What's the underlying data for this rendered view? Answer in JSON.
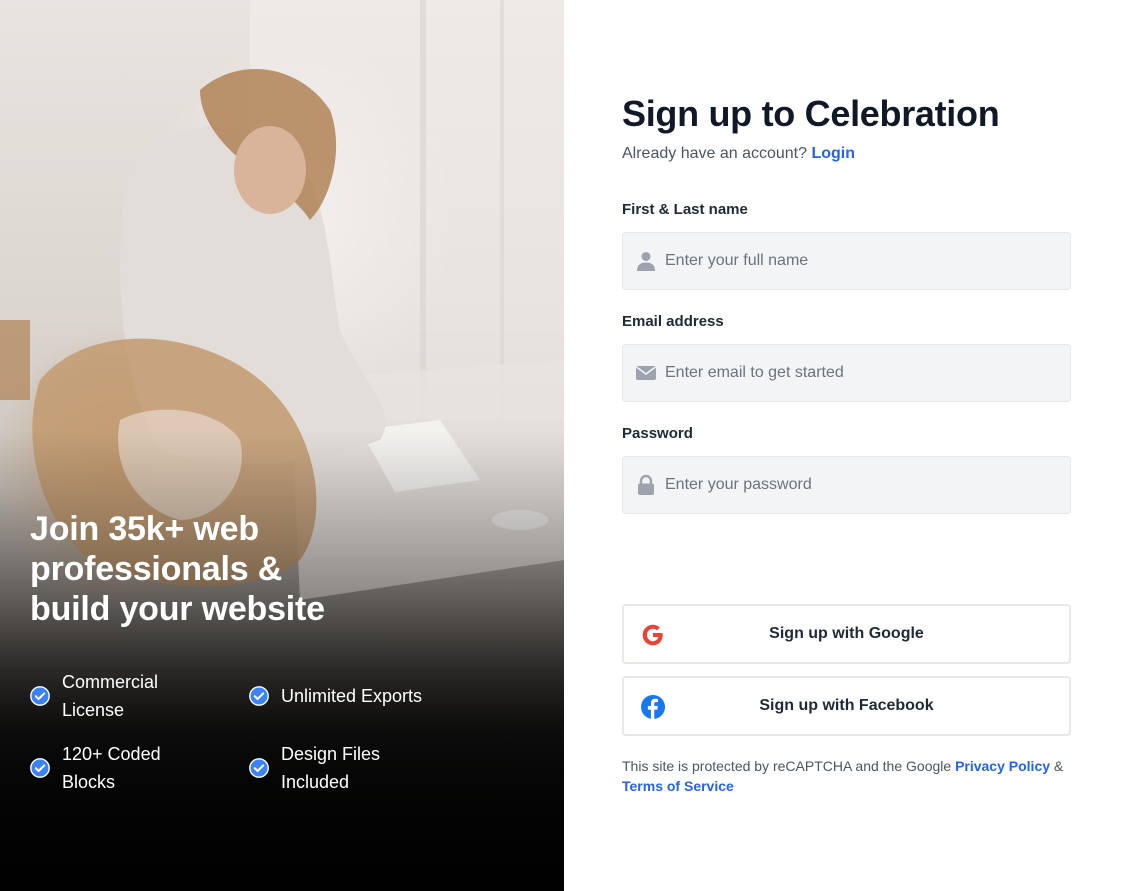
{
  "hero": {
    "title_lines": [
      "Join 35k+ web",
      "professionals &",
      "build your website"
    ],
    "features": [
      {
        "label": "Commercial License",
        "icon": "check-badge-icon"
      },
      {
        "label": "Unlimited Exports",
        "icon": "check-badge-icon"
      },
      {
        "label": "120+ Coded Blocks",
        "icon": "check-badge-icon"
      },
      {
        "label": "Design Files Included",
        "icon": "check-badge-icon"
      }
    ]
  },
  "form": {
    "title": "Sign up to Celebration",
    "have_account_text": "Already have an account?",
    "login_link": "Login",
    "fields": {
      "name": {
        "label": "First & Last name",
        "placeholder": "Enter your full name",
        "value": "",
        "icon": "user-icon"
      },
      "email": {
        "label": "Email address",
        "placeholder": "Enter email to get started",
        "value": "",
        "icon": "envelope-icon"
      },
      "password": {
        "label": "Password",
        "placeholder": "Enter your password",
        "value": "",
        "icon": "lock-icon"
      }
    },
    "google_button": {
      "label": "Sign up with Google",
      "icon": "google-icon"
    },
    "facebook_button": {
      "label": "Sign up with Facebook",
      "icon": "facebook-icon"
    },
    "legal": {
      "prefix": "This site is protected by reCAPTCHA and the Google",
      "privacy_link": "Privacy Policy",
      "ampersand": "&",
      "terms_link": "Terms of Service"
    }
  },
  "colors": {
    "accent": "#2563eb",
    "check_badge": "#3b82f6",
    "google_red": "#ea4335",
    "facebook_blue": "#1877f2",
    "input_bg": "#f3f4f6"
  }
}
